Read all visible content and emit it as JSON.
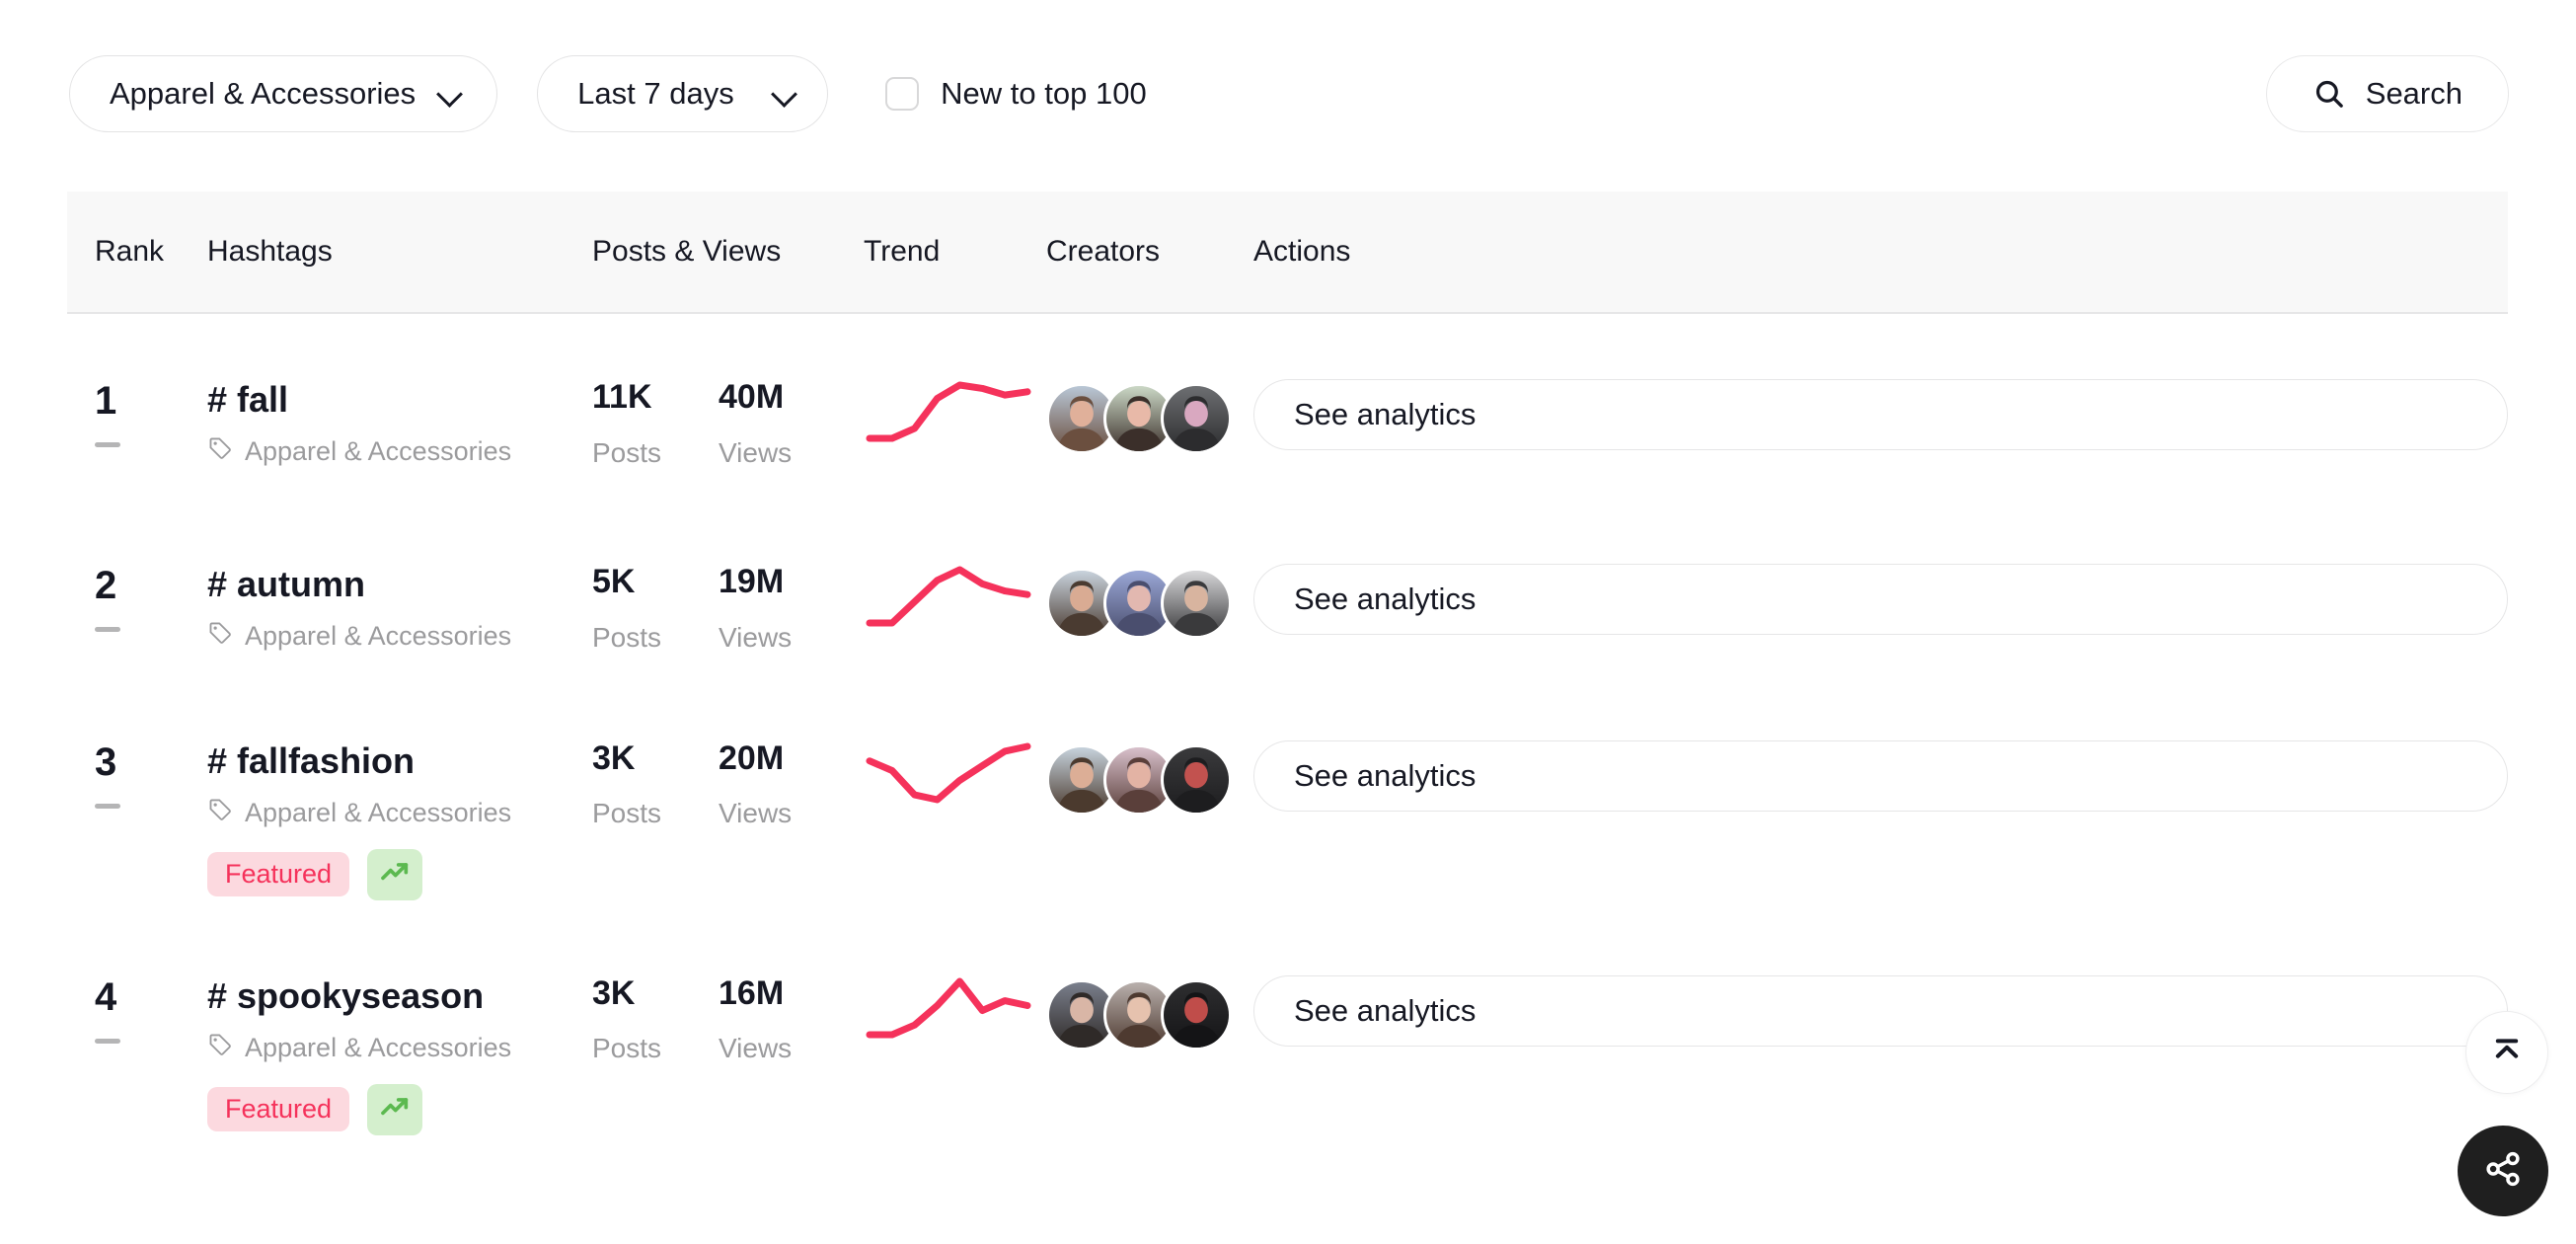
{
  "filters": {
    "category": {
      "label": "Apparel & Accessories"
    },
    "period": {
      "label": "Last 7 days"
    },
    "new_to_top": {
      "label": "New to top 100",
      "checked": false
    },
    "search": {
      "label": "Search"
    }
  },
  "table": {
    "headers": {
      "rank": "Rank",
      "hashtags": "Hashtags",
      "posts_views": "Posts & Views",
      "trend": "Trend",
      "creators": "Creators",
      "actions": "Actions"
    },
    "labels": {
      "posts": "Posts",
      "views": "Views",
      "featured": "Featured",
      "see_analytics": "See analytics"
    },
    "rows": [
      {
        "rank": "1",
        "rank_change": "flat",
        "hashtag": "# fall",
        "category": "Apparel & Accessories",
        "featured": false,
        "posts": "11K",
        "views": "40M",
        "trend_points": [
          30,
          30,
          27,
          18,
          14,
          15,
          17,
          16
        ],
        "creators": 3
      },
      {
        "rank": "2",
        "rank_change": "flat",
        "hashtag": "# autumn",
        "category": "Apparel & Accessories",
        "featured": false,
        "posts": "5K",
        "views": "19M",
        "trend_points": [
          28,
          28,
          22,
          16,
          13,
          17,
          19,
          20
        ],
        "creators": 3
      },
      {
        "rank": "3",
        "rank_change": "flat",
        "hashtag": "# fallfashion",
        "category": "Apparel & Accessories",
        "featured": true,
        "posts": "3K",
        "views": "20M",
        "trend_points": [
          17,
          19,
          24,
          25,
          21,
          18,
          15,
          14
        ],
        "creators": 3
      },
      {
        "rank": "4",
        "rank_change": "flat",
        "hashtag": "# spookyseason",
        "category": "Apparel & Accessories",
        "featured": true,
        "posts": "3K",
        "views": "16M",
        "trend_points": [
          24,
          24,
          22,
          18,
          13,
          19,
          17,
          18
        ],
        "creators": 3
      }
    ]
  },
  "floating": {
    "scroll_top": "scroll-to-top",
    "share": "share"
  },
  "colors": {
    "accent": "#fe2c55",
    "trend_line": "#f5325b",
    "featured_bg": "#fcd9df",
    "featured_text": "#f5325b",
    "trend_badge_bg": "#d4efcd",
    "trend_badge_icon": "#5cb950",
    "header_bg": "#f8f8f8",
    "muted_text": "#9b9b9d"
  }
}
